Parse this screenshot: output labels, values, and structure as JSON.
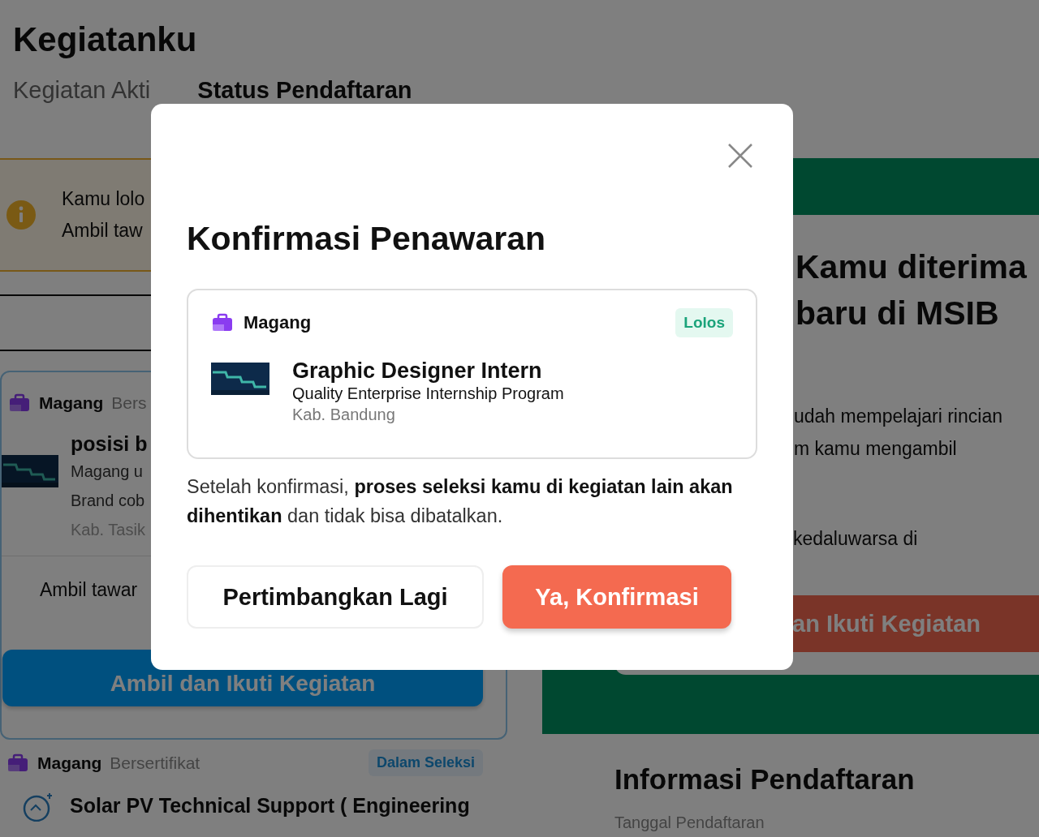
{
  "page": {
    "title": "Kegiatanku",
    "tabs": [
      {
        "label": "Kegiatan Akti",
        "selected": false
      },
      {
        "label": "Status Pendaftaran",
        "selected": true
      }
    ]
  },
  "alert": {
    "lines": [
      "Kamu lolo",
      "Ambil taw"
    ]
  },
  "activities": [
    {
      "program": "Magang",
      "program_type": "Bers",
      "title": "posisi b",
      "lines": [
        "Magang u",
        "Brand cob"
      ],
      "location": "Kab. Tasik",
      "offer_text": "Ambil tawar",
      "button": "Ambil dan Ikuti Kegiatan"
    },
    {
      "program": "Magang",
      "program_type": "Bersertifikat",
      "status": "Dalam Seleksi",
      "title": "Solar PV Technical Support ( Engineering"
    }
  ],
  "offer_panel": {
    "heading_lines": [
      "Kamu diterima",
      "baru di MSIB"
    ],
    "body_lines": [
      "udah mempelajari rincian",
      "m kamu mengambil"
    ],
    "expiry": "kedaluwarsa di",
    "button": "an Ikuti Kegiatan"
  },
  "registration_info": {
    "title": "Informasi Pendaftaran",
    "label": "Tanggal Pendaftaran"
  },
  "modal": {
    "title": "Konfirmasi Penawaran",
    "offer": {
      "program": "Magang",
      "status": "Lolos",
      "position": "Graphic Designer Intern",
      "program_name": "Quality Enterprise Internship Program",
      "location": "Kab. Bandung"
    },
    "message": "Setelah konfirmasi, **proses seleksi kamu di kegiatan lain akan dihentikan** dan tidak bisa dibatalkan.",
    "buttons": [
      {
        "label": "Pertimbangkan Lagi",
        "kind": "secondary"
      },
      {
        "label": "Ya, Konfirmasi",
        "kind": "primary"
      }
    ]
  }
}
